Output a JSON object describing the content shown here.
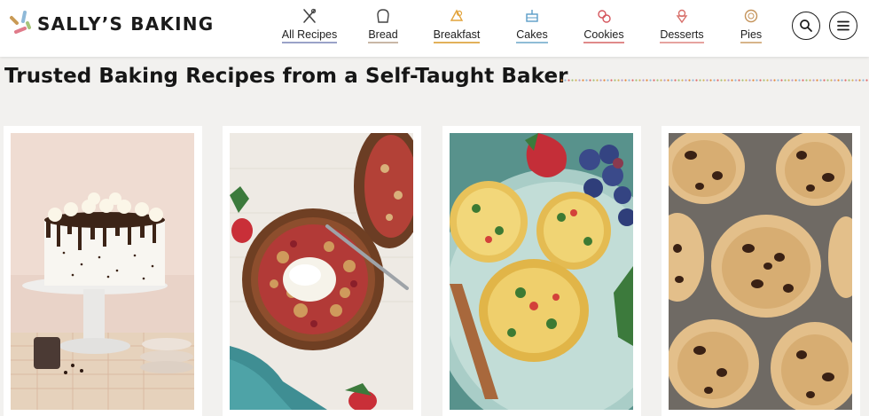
{
  "brand": {
    "name": "SALLY’S BAKING"
  },
  "nav": {
    "items": [
      {
        "label": "All Recipes",
        "icon": "utensils-icon",
        "accent": "#9aa2c8"
      },
      {
        "label": "Bread",
        "icon": "bread-icon",
        "accent": "#c9b7a6"
      },
      {
        "label": "Breakfast",
        "icon": "breakfast-icon",
        "accent": "#e2b15a"
      },
      {
        "label": "Cakes",
        "icon": "cake-icon",
        "accent": "#8fbcd6"
      },
      {
        "label": "Cookies",
        "icon": "cookies-icon",
        "accent": "#e08a8a"
      },
      {
        "label": "Desserts",
        "icon": "dessert-icon",
        "accent": "#e6a39f"
      },
      {
        "label": "Pies",
        "icon": "pie-icon",
        "accent": "#d7b48a"
      }
    ],
    "search_icon": "search-icon",
    "menu_icon": "menu-icon"
  },
  "main": {
    "title": "Trusted Baking Recipes from a Self-Taught Baker",
    "cards": [
      {
        "image": "layer-cake-photo"
      },
      {
        "image": "berry-crumble-photo"
      },
      {
        "image": "egg-muffins-photo"
      },
      {
        "image": "chocolate-chip-cookies-photo"
      }
    ]
  },
  "colors": {
    "background": "#f2f1ef",
    "text": "#1b1b1b",
    "dots": [
      "#e58a3a",
      "#8fb8d9",
      "#e06b6b",
      "#a3c27a",
      "#d6b35a",
      "#b59acb"
    ]
  }
}
